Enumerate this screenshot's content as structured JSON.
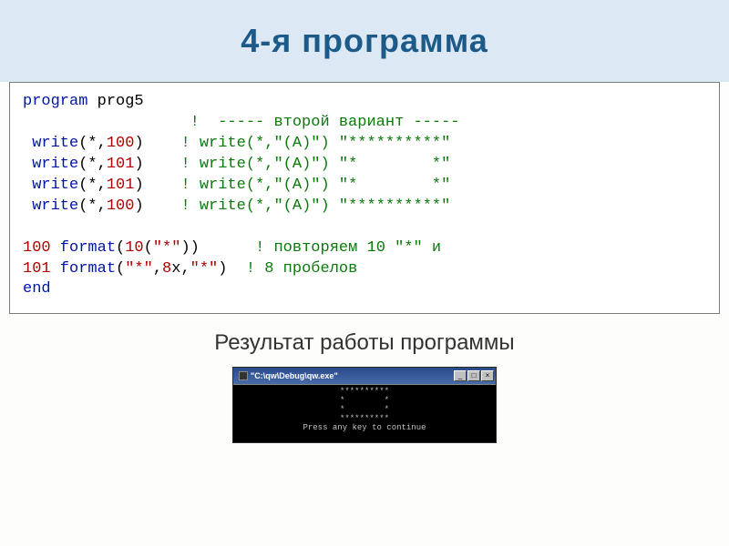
{
  "title": "4-я программа",
  "code": {
    "l1a": "program",
    "l1b": " prog5",
    "l2a": "                  !  ----- второй вариант -----",
    "l3a": " write",
    "l3b": "(*,",
    "l3c": "100",
    "l3d": ")    ",
    "l3e": "! write(*,\"(A)\") \"**********\"",
    "l4a": " write",
    "l4b": "(*,",
    "l4c": "101",
    "l4d": ")    ",
    "l4e": "! write(*,\"(A)\") \"*        *\"",
    "l5a": " write",
    "l5b": "(*,",
    "l5c": "101",
    "l5d": ")    ",
    "l5e": "! write(*,\"(A)\") \"*        *\"",
    "l6a": " write",
    "l6b": "(*,",
    "l6c": "100",
    "l6d": ")    ",
    "l6e": "! write(*,\"(A)\") \"**********\"",
    "l8a": "100",
    "l8b": " format",
    "l8c": "(",
    "l8d": "10",
    "l8e": "(",
    "l8f": "\"*\"",
    "l8g": "))      ",
    "l8h": "! повторяем 10 \"*\" и",
    "l9a": "101",
    "l9b": " format",
    "l9c": "(",
    "l9d": "\"*\"",
    "l9e": ",",
    "l9f": "8",
    "l9g": "x,",
    "l9h": "\"*\"",
    "l9i": ")  ",
    "l9j": "! 8 пробелов",
    "l10": "end"
  },
  "result_caption": "Результат работы программы",
  "console": {
    "title": "\"C:\\qw\\Debug\\qw.exe\"",
    "btn_min": "_",
    "btn_max": "□",
    "btn_close": "×",
    "output": "**********\n*        *\n*        *\n**********\nPress any key to continue"
  }
}
